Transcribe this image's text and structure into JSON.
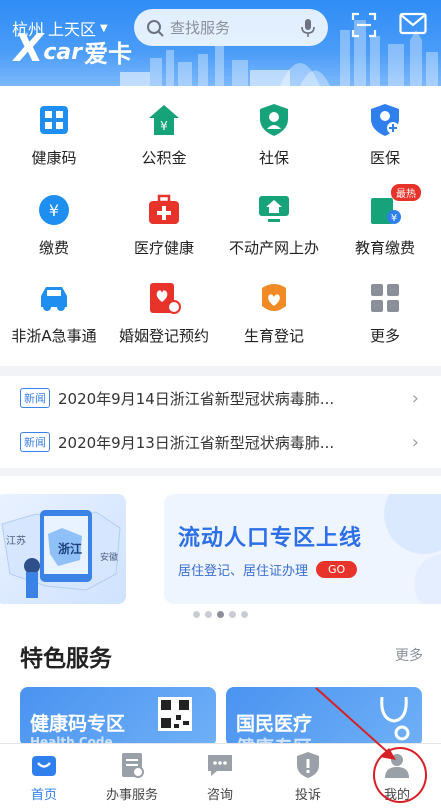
{
  "header": {
    "city": "杭州",
    "district": "上天区",
    "search_placeholder": "查找服务",
    "icons": [
      "scan-icon",
      "mail-icon",
      "mic-icon",
      "search-icon"
    ]
  },
  "watermark": {
    "x": "X",
    "car": "car",
    "cn": "爱卡"
  },
  "services": [
    {
      "label": "健康码",
      "icon": "health-code-icon",
      "color": "#1e8ff0"
    },
    {
      "label": "公积金",
      "icon": "house-fund-icon",
      "color": "#17a37a"
    },
    {
      "label": "社保",
      "icon": "shield-icon",
      "color": "#17a37a"
    },
    {
      "label": "医保",
      "icon": "medical-insurance-icon",
      "color": "#2f80ed"
    },
    {
      "label": "缴费",
      "icon": "yuan-icon",
      "color": "#1e8ff0"
    },
    {
      "label": "医疗健康",
      "icon": "medical-kit-icon",
      "color": "#e8332b"
    },
    {
      "label": "不动产网上办",
      "icon": "property-icon",
      "color": "#17a37a"
    },
    {
      "label": "教育缴费",
      "icon": "education-icon",
      "color": "#17a37a",
      "badge": "最热"
    },
    {
      "label": "非浙A急事通",
      "icon": "car-icon",
      "color": "#1e8ff0"
    },
    {
      "label": "婚姻登记预约",
      "icon": "marriage-icon",
      "color": "#e8332b"
    },
    {
      "label": "生育登记",
      "icon": "birth-icon",
      "color": "#f08a24"
    },
    {
      "label": "更多",
      "icon": "more-grid-icon",
      "color": "#8a8f99"
    }
  ],
  "news": [
    {
      "tag": "新闻",
      "text": "2020年9月14日浙江省新型冠状病毒肺..."
    },
    {
      "tag": "新闻",
      "text": "2020年9月13日浙江省新型冠状病毒肺..."
    }
  ],
  "banner": {
    "left_labels": [
      "江苏",
      "浙江",
      "安徽"
    ],
    "title": "流动人口专区上线",
    "subtitle": "居住登记、居住证办理",
    "go": "GO",
    "dots": 5,
    "active_dot": 3
  },
  "featured": {
    "title": "特色服务",
    "more": "更多",
    "cards": [
      {
        "title": "健康码专区",
        "sub": "Health Code"
      },
      {
        "title": "国民医疗",
        "sub": "健康专区"
      }
    ]
  },
  "tabbar": [
    {
      "label": "首页",
      "icon": "home-icon",
      "active": true
    },
    {
      "label": "办事服务",
      "icon": "service-icon",
      "active": false
    },
    {
      "label": "咨询",
      "icon": "chat-icon",
      "active": false
    },
    {
      "label": "投诉",
      "icon": "complaint-icon",
      "active": false
    },
    {
      "label": "我的",
      "icon": "profile-icon",
      "active": false
    }
  ]
}
